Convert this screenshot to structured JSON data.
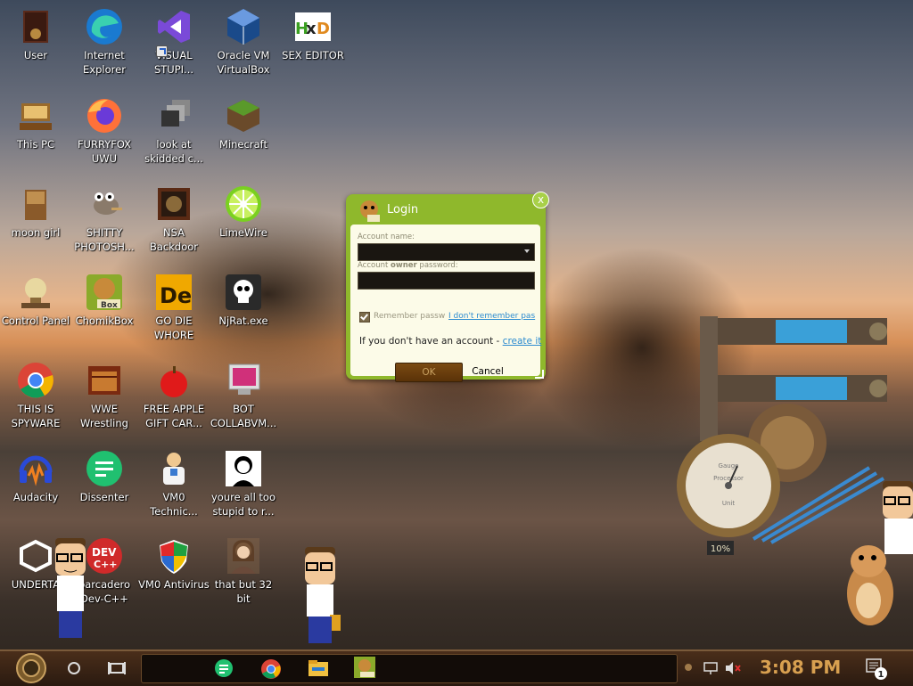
{
  "desktop_icons": [
    {
      "label": "User",
      "name": "user-folder-icon"
    },
    {
      "label": "Internet Explorer",
      "name": "edge-browser-icon"
    },
    {
      "label": "VISUAL STUPI...",
      "name": "visual-studio-icon"
    },
    {
      "label": "Oracle VM VirtualBox",
      "name": "virtualbox-icon"
    },
    {
      "label": "SEX EDITOR",
      "name": "hex-editor-icon"
    },
    {
      "label": "This PC",
      "name": "this-pc-icon"
    },
    {
      "label": "FURRYFOX UWU",
      "name": "firefox-icon"
    },
    {
      "label": "look at skidded c...",
      "name": "shortcut-windows-icon"
    },
    {
      "label": "Minecraft",
      "name": "minecraft-icon"
    },
    {
      "label": "moon girl",
      "name": "moon-girl-icon"
    },
    {
      "label": "SHITTY PHOTOSH...",
      "name": "gimp-icon"
    },
    {
      "label": "NSA Backdoor",
      "name": "nsa-backdoor-icon"
    },
    {
      "label": "LimeWire",
      "name": "limewire-icon"
    },
    {
      "label": "Control Panel",
      "name": "control-panel-icon"
    },
    {
      "label": "ChomikBox",
      "name": "chomikbox-icon"
    },
    {
      "label": "GO DIE WHORE",
      "name": "go-die-icon"
    },
    {
      "label": "NjRat.exe",
      "name": "skull-icon"
    },
    {
      "label": "THIS IS SPYWARE",
      "name": "chrome-icon"
    },
    {
      "label": "WWE Wrestling",
      "name": "wwe-wrestling-icon"
    },
    {
      "label": "FREE APPLE GIFT CAR...",
      "name": "apple-icon"
    },
    {
      "label": "BOT COLLABVM...",
      "name": "monitor-icon"
    },
    {
      "label": "Audacity",
      "name": "audacity-icon"
    },
    {
      "label": "Dissenter",
      "name": "dissenter-icon"
    },
    {
      "label": "VM0 Technic...",
      "name": "technician-icon"
    },
    {
      "label": "youre all too stupid to r...",
      "name": "portrait-icon"
    },
    {
      "label": "UNDERTA",
      "name": "unity-icon"
    },
    {
      "label": "barcadero Dev-C++",
      "name": "devcpp-icon"
    },
    {
      "label": "VM0 Antivirus",
      "name": "shield-icon"
    },
    {
      "label": "that but 32 bit",
      "name": "portrait-lady-icon"
    }
  ],
  "login": {
    "title": "Login",
    "close_label": "x",
    "account_name_label": "Account name:",
    "account_owner_prefix": "Account ",
    "account_owner_bold": "owner",
    "account_owner_suffix": " password:",
    "remember_label": "Remember passw",
    "forgot_label": "I don't remember pas",
    "no_account_text": "If you don't have an account - ",
    "create_link": "create it",
    "ok_label": "OK",
    "cancel_label": "Cancel"
  },
  "taskbar": {
    "clock": "3:08 PM",
    "notification_count": "1"
  },
  "gauge": {
    "face_top": "Gauge",
    "face_mid": "Processor",
    "face_unit": "Unit",
    "percent": "10%"
  },
  "colors": {
    "dialog_green": "#8fb82c",
    "clock_orange": "#d8a050"
  }
}
